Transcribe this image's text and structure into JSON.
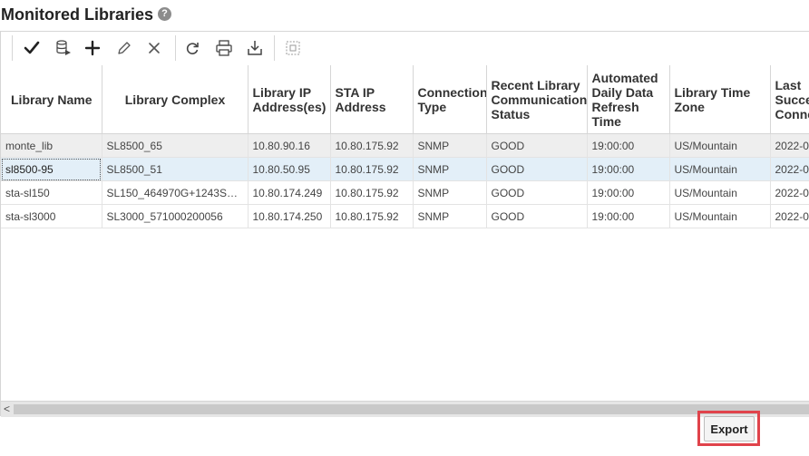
{
  "page": {
    "title": "Monitored Libraries",
    "help_icon": "?"
  },
  "toolbar": {
    "icons": [
      "checkmark-icon",
      "library-run-icon",
      "add-icon",
      "edit-pencil-icon",
      "delete-x-icon",
      "refresh-icon",
      "print-icon",
      "download-icon",
      "detach-icon"
    ]
  },
  "table": {
    "columns": [
      "Library Name",
      "Library Complex",
      "Library IP Address(es)",
      "STA IP Address",
      "Connection Type",
      "Recent Library Communication Status",
      "Automated Daily Data Refresh Time",
      "Library Time Zone",
      "Last Successful Connection"
    ],
    "rows": [
      [
        "monte_lib",
        "SL8500_65",
        "10.80.90.16",
        "10.80.175.92",
        "SNMP",
        "GOOD",
        "19:00:00",
        "US/Mountain",
        "2022-0"
      ],
      [
        "sl8500-95",
        "SL8500_51",
        "10.80.50.95",
        "10.80.175.92",
        "SNMP",
        "GOOD",
        "19:00:00",
        "US/Mountain",
        "2022-0"
      ],
      [
        "sta-sl150",
        "SL150_464970G+1243S…",
        "10.80.174.249",
        "10.80.175.92",
        "SNMP",
        "GOOD",
        "19:00:00",
        "US/Mountain",
        "2022-0"
      ],
      [
        "sta-sl3000",
        "SL3000_571000200056",
        "10.80.174.250",
        "10.80.175.92",
        "SNMP",
        "GOOD",
        "19:00:00",
        "US/Mountain",
        "2022-0"
      ]
    ],
    "selected_row": 1
  },
  "scrollbar": {
    "left_arrow": "<"
  },
  "footer": {
    "export_label": "Export"
  },
  "colors": {
    "highlight": "#e0434b",
    "selected_row": "#e3eff8"
  }
}
